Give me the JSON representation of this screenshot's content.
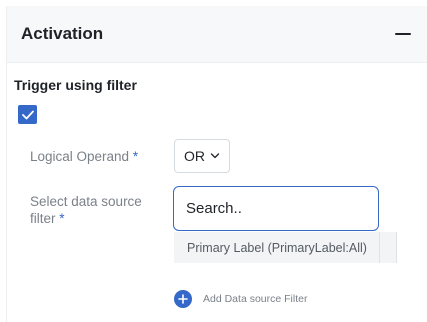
{
  "panel": {
    "title": "Activation",
    "collapse_icon": "minus-icon"
  },
  "trigger": {
    "section_title": "Trigger using filter",
    "checkbox_checked": true,
    "checkbox_icon": "checkmark-icon"
  },
  "form": {
    "operand_label": "Logical Operand",
    "operand_required": "*",
    "operand_value": "OR",
    "operand_chevron_icon": "chevron-down-icon",
    "filter_label": "Select data source filter",
    "filter_required": "*",
    "search_placeholder": "Search..",
    "options": [
      {
        "label": "Primary Label (PrimaryLabel:All)"
      }
    ]
  },
  "actions": {
    "add_filter_label": "Add Data source Filter",
    "add_icon": "plus-circle-icon"
  },
  "colors": {
    "accent": "#3468c9",
    "header_bg": "#f7f8f9",
    "label_text": "#7b8189",
    "option_bg": "#f3f4f6"
  }
}
